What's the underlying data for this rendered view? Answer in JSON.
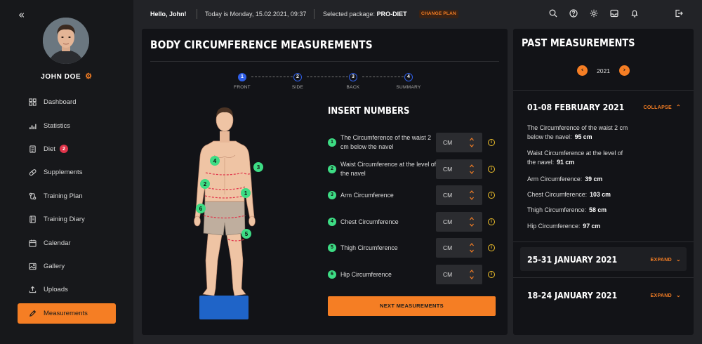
{
  "sidebar": {
    "collapse_icon": "«",
    "user_name": "JOHN DOE",
    "items": [
      {
        "label": "Dashboard",
        "icon": "dashboard-icon"
      },
      {
        "label": "Statistics",
        "icon": "statistics-icon"
      },
      {
        "label": "Diet",
        "icon": "diet-icon",
        "badge": "2"
      },
      {
        "label": "Supplements",
        "icon": "pill-icon"
      },
      {
        "label": "Training Plan",
        "icon": "training-plan-icon"
      },
      {
        "label": "Training Diary",
        "icon": "diary-icon"
      },
      {
        "label": "Calendar",
        "icon": "calendar-icon"
      },
      {
        "label": "Gallery",
        "icon": "gallery-icon"
      },
      {
        "label": "Uploads",
        "icon": "upload-icon"
      },
      {
        "label": "Measurements",
        "icon": "pencil-icon",
        "active": true
      }
    ]
  },
  "header": {
    "greeting": "Hello, John!",
    "date_text": "Today is Monday, 15.02.2021, 09:37",
    "package_label": "Selected package:",
    "package_name": "PRO-DIET",
    "change_plan": "CHANGE PLAN"
  },
  "main": {
    "title": "BODY CIRCUMFERENCE MEASUREMENTS",
    "steps": [
      {
        "num": "1",
        "label": "FRONT",
        "done": true
      },
      {
        "num": "2",
        "label": "SIDE"
      },
      {
        "num": "3",
        "label": "BACK"
      },
      {
        "num": "4",
        "label": "SUMMARY"
      }
    ],
    "insert_title": "INSERT NUMBERS",
    "unit": "CM",
    "measurements": [
      {
        "num": "1",
        "label": "The Circumference of the waist 2 cm below the navel"
      },
      {
        "num": "2",
        "label": "Waist Circumference at the level of the navel"
      },
      {
        "num": "3",
        "label": "Arm Circumference"
      },
      {
        "num": "4",
        "label": "Chest Circumference"
      },
      {
        "num": "5",
        "label": "Thigh Circumference"
      },
      {
        "num": "6",
        "label": "Hip Circumference"
      }
    ],
    "next_button": "NEXT MEASUREMENTS"
  },
  "past": {
    "title": "PAST MEASUREMENTS",
    "year": "2021",
    "periods": [
      {
        "label": "01-08 FEBRUARY 2021",
        "toggle": "COLLAPSE",
        "details": [
          {
            "label": "The Circumference of the waist 2 cm below the navel:",
            "value": "95 cm"
          },
          {
            "label": "Waist Circumference at the level of the navel:",
            "value": "91 cm"
          },
          {
            "label": "Arm Circumference:",
            "value": "39 cm"
          },
          {
            "label": "Chest Circumference:",
            "value": "103 cm"
          },
          {
            "label": "Thigh Circumference:",
            "value": "58 cm"
          },
          {
            "label": "Hip Circumference:",
            "value": "97 cm"
          }
        ]
      },
      {
        "label": "25-31 JANUARY 2021",
        "toggle": "EXPAND"
      },
      {
        "label": "18-24 JANUARY 2021",
        "toggle": "EXPAND"
      }
    ]
  },
  "colors": {
    "accent": "#f57e24",
    "marker": "#3ddc84",
    "step": "#2f5ee6",
    "badge": "#e0344a"
  }
}
